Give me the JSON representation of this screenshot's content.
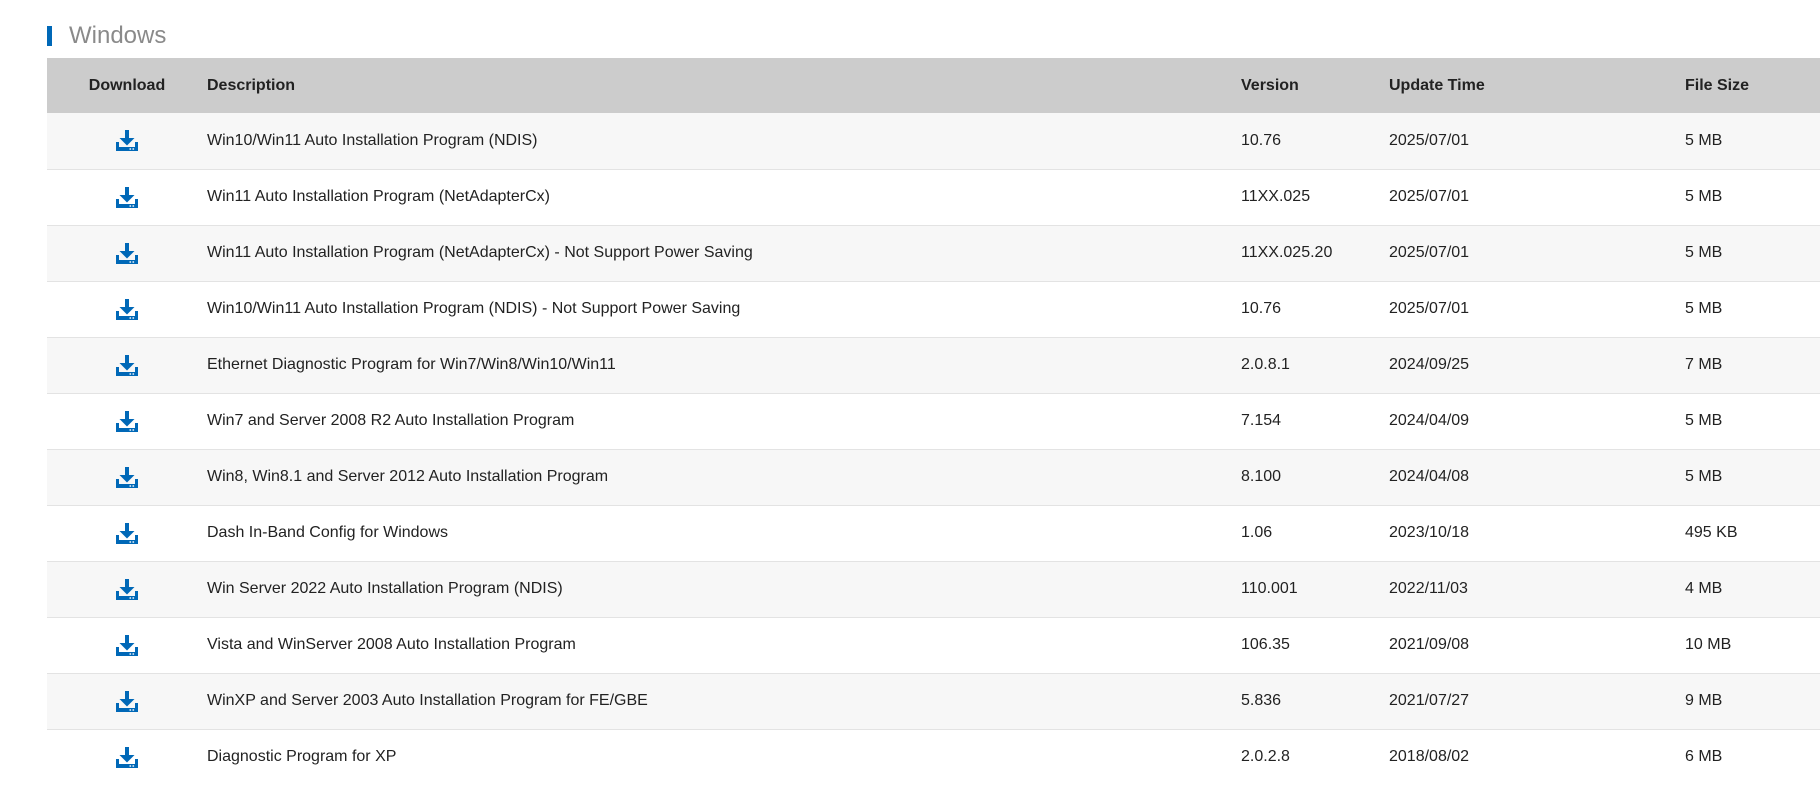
{
  "section": {
    "title": "Windows"
  },
  "colors": {
    "accent": "#0068b7",
    "header_bg": "#cccccc",
    "title_gray": "#8a8a8a"
  },
  "table": {
    "headers": {
      "download": "Download",
      "description": "Description",
      "version": "Version",
      "update_time": "Update Time",
      "file_size": "File Size"
    },
    "download_icon": "download-tray-icon",
    "rows": [
      {
        "description": "Win10/Win11 Auto Installation Program (NDIS)",
        "version": "10.76",
        "update_time": "2025/07/01",
        "file_size": "5 MB"
      },
      {
        "description": "Win11 Auto Installation Program (NetAdapterCx)",
        "version": "11XX.025",
        "update_time": "2025/07/01",
        "file_size": "5 MB"
      },
      {
        "description": "Win11 Auto Installation Program (NetAdapterCx) - Not Support Power Saving",
        "version": "11XX.025.20",
        "update_time": "2025/07/01",
        "file_size": "5 MB"
      },
      {
        "description": "Win10/Win11 Auto Installation Program (NDIS) - Not Support Power Saving",
        "version": "10.76",
        "update_time": "2025/07/01",
        "file_size": "5 MB"
      },
      {
        "description": "Ethernet Diagnostic Program for Win7/Win8/Win10/Win11",
        "version": "2.0.8.1",
        "update_time": "2024/09/25",
        "file_size": "7 MB"
      },
      {
        "description": "Win7 and Server 2008 R2 Auto Installation Program",
        "version": "7.154",
        "update_time": "2024/04/09",
        "file_size": "5 MB"
      },
      {
        "description": "Win8, Win8.1 and Server 2012 Auto Installation Program",
        "version": "8.100",
        "update_time": "2024/04/08",
        "file_size": "5 MB"
      },
      {
        "description": "Dash In-Band Config for Windows",
        "version": "1.06",
        "update_time": "2023/10/18",
        "file_size": "495 KB"
      },
      {
        "description": "Win Server 2022 Auto Installation Program (NDIS)",
        "version": "110.001",
        "update_time": "2022/11/03",
        "file_size": "4 MB"
      },
      {
        "description": "Vista and WinServer 2008 Auto Installation Program",
        "version": "106.35",
        "update_time": "2021/09/08",
        "file_size": "10 MB"
      },
      {
        "description": "WinXP and Server 2003 Auto Installation Program for FE/GBE",
        "version": "5.836",
        "update_time": "2021/07/27",
        "file_size": "9 MB"
      },
      {
        "description": "Diagnostic Program for XP",
        "version": "2.0.2.8",
        "update_time": "2018/08/02",
        "file_size": "6 MB"
      }
    ]
  }
}
